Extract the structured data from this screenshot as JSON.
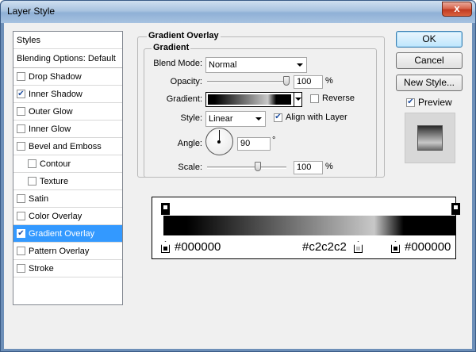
{
  "window": {
    "title": "Layer Style",
    "close_label": "x"
  },
  "styles_list": {
    "header": "Styles",
    "blending": "Blending Options: Default",
    "items": [
      {
        "label": "Drop Shadow",
        "checked": false,
        "indent": false,
        "selected": false
      },
      {
        "label": "Inner Shadow",
        "checked": true,
        "indent": false,
        "selected": false
      },
      {
        "label": "Outer Glow",
        "checked": false,
        "indent": false,
        "selected": false
      },
      {
        "label": "Inner Glow",
        "checked": false,
        "indent": false,
        "selected": false
      },
      {
        "label": "Bevel and Emboss",
        "checked": false,
        "indent": false,
        "selected": false
      },
      {
        "label": "Contour",
        "checked": false,
        "indent": true,
        "selected": false
      },
      {
        "label": "Texture",
        "checked": false,
        "indent": true,
        "selected": false
      },
      {
        "label": "Satin",
        "checked": false,
        "indent": false,
        "selected": false
      },
      {
        "label": "Color Overlay",
        "checked": false,
        "indent": false,
        "selected": false
      },
      {
        "label": "Gradient Overlay",
        "checked": true,
        "indent": false,
        "selected": true
      },
      {
        "label": "Pattern Overlay",
        "checked": false,
        "indent": false,
        "selected": false
      },
      {
        "label": "Stroke",
        "checked": false,
        "indent": false,
        "selected": false
      }
    ]
  },
  "gradient_overlay": {
    "group_title": "Gradient Overlay",
    "subgroup_title": "Gradient",
    "blend_mode_label": "Blend Mode:",
    "blend_mode_value": "Normal",
    "opacity_label": "Opacity:",
    "opacity_value": "100",
    "opacity_fraction": 1.0,
    "percent_sign": "%",
    "gradient_label": "Gradient:",
    "reverse_label": "Reverse",
    "reverse_checked": false,
    "style_label": "Style:",
    "style_value": "Linear",
    "align_label": "Align with Layer",
    "align_checked": true,
    "angle_label": "Angle:",
    "angle_value": "90",
    "degree_sign": "°",
    "scale_label": "Scale:",
    "scale_value": "100",
    "scale_fraction": 0.6
  },
  "buttons": {
    "ok": "OK",
    "cancel": "Cancel",
    "new_style": "New Style...",
    "preview_label": "Preview",
    "preview_checked": true
  },
  "gradient_editor": {
    "stops": [
      {
        "label": "#000000",
        "color": "#000000"
      },
      {
        "label": "#c2c2c2",
        "color": "#c2c2c2"
      },
      {
        "label": "#000000",
        "color": "#000000"
      }
    ]
  },
  "colors": {
    "selection": "#3399ff",
    "check": "#1f4fa1"
  }
}
